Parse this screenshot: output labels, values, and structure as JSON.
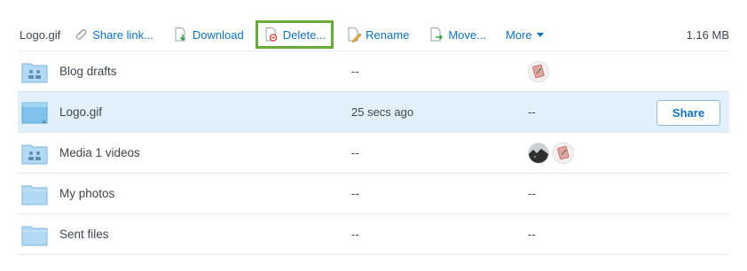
{
  "toolbar": {
    "filename": "Logo.gif",
    "share_link_label": "Share link...",
    "download_label": "Download",
    "delete_label": "Delete...",
    "rename_label": "Rename",
    "move_label": "Move...",
    "more_label": "More",
    "file_size": "1.16 MB"
  },
  "files": [
    {
      "name": "Blog drafts",
      "modified": "--",
      "members": "",
      "type": "shared-folder",
      "avatars": [
        "drawing-avatar"
      ]
    },
    {
      "name": "Logo.gif",
      "modified": "25 secs ago",
      "members": "--",
      "type": "image-file",
      "selected": true,
      "share_label": "Share"
    },
    {
      "name": "Media 1 videos",
      "modified": "--",
      "members": "",
      "type": "shared-folder",
      "avatars": [
        "cat-photo-avatar",
        "drawing-avatar"
      ]
    },
    {
      "name": "My photos",
      "modified": "--",
      "members": "--",
      "type": "folder"
    },
    {
      "name": "Sent files",
      "modified": "--",
      "members": "--",
      "type": "folder"
    }
  ],
  "colors": {
    "link": "#0d72c5",
    "highlight_border": "#6aac3c",
    "selected_row": "#e2f0fb",
    "folder_fill": "#b3daf5"
  },
  "icons": {
    "share_link": "paperclip-icon",
    "download": "download-icon",
    "delete": "delete-icon",
    "rename": "rename-pencil-icon",
    "move": "move-arrow-icon",
    "more": "chevron-down-icon"
  }
}
